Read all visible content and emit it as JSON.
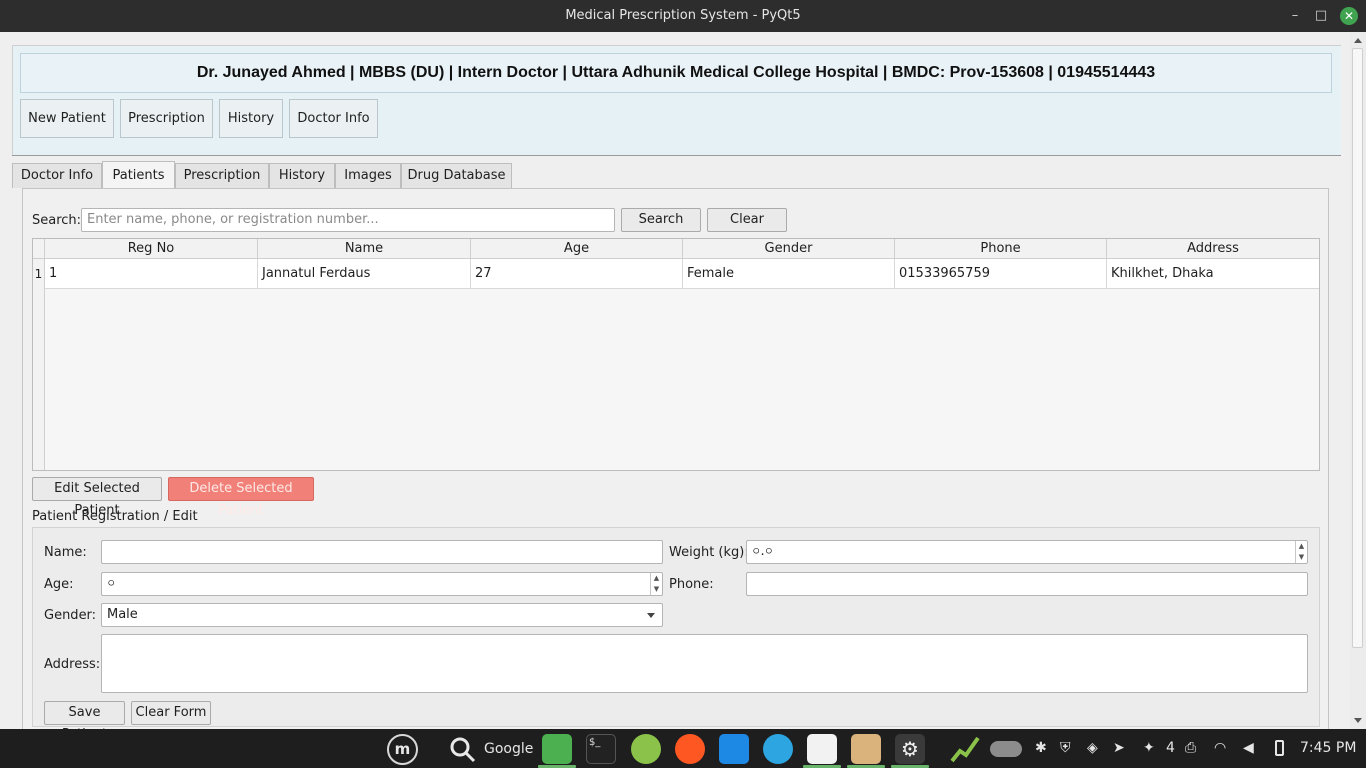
{
  "window": {
    "title": "Medical Prescription System - PyQt5",
    "min_glyph": "–",
    "max_glyph": "□",
    "close_glyph": "✕"
  },
  "header": {
    "banner": "Dr. Junayed Ahmed | MBBS (DU) | Intern Doctor | Uttara Adhunik Medical College Hospital | BMDC: Prov-153608 | 01945514443",
    "buttons": [
      "New Patient",
      "Prescription",
      "History",
      "Doctor Info"
    ]
  },
  "tabs": [
    "Doctor Info",
    "Patients",
    "Prescription",
    "History",
    "Images",
    "Drug Database"
  ],
  "active_tab": "Patients",
  "search": {
    "label": "Search:",
    "placeholder": "Enter name, phone, or registration number...",
    "search_label": "Search",
    "clear_label": "Clear"
  },
  "table": {
    "columns": [
      "Reg No",
      "Name",
      "Age",
      "Gender",
      "Phone",
      "Address"
    ],
    "rows": [
      {
        "index": "1",
        "cells": [
          "1",
          "Jannatul Ferdaus",
          "27",
          "Female",
          "01533965759",
          "Khilkhet, Dhaka"
        ]
      }
    ]
  },
  "actions": {
    "edit_label": "Edit Selected Patient",
    "delete_label": "Delete Selected Patient"
  },
  "form": {
    "section_title": "Patient Registration / Edit",
    "name_label": "Name:",
    "name_value": "",
    "weight_label": "Weight (kg):",
    "weight_value": "০.০",
    "age_label": "Age:",
    "age_value": "০",
    "phone_label": "Phone:",
    "phone_value": "",
    "gender_label": "Gender:",
    "gender_value": "Male",
    "address_label": "Address:",
    "address_value": "",
    "save_label": "Save Patient",
    "clear_label": "Clear Form"
  },
  "taskbar": {
    "search_text": "Google",
    "tray_count": "4",
    "clock": "7:45 PM"
  },
  "colors": {
    "header_bg": "#e6f1f6",
    "delete_button": "#f08078",
    "taskbar_bg": "#1e1e1e",
    "close_button": "#3fa350"
  }
}
